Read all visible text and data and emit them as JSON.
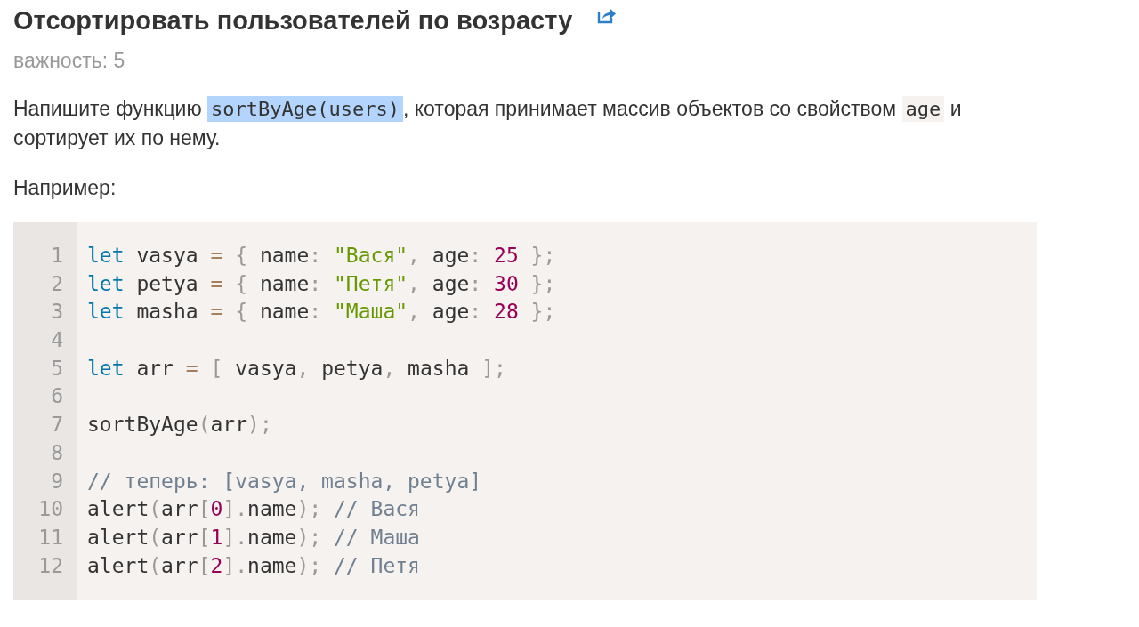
{
  "task": {
    "title": "Отсортировать пользователей по возрасту",
    "importance": "важность: 5"
  },
  "description": [
    {
      "kind": "text",
      "text": "Напишите функцию "
    },
    {
      "kind": "code",
      "text": "sortByAge(users)",
      "highlighted": true
    },
    {
      "kind": "text",
      "text": ", которая принимает массив объектов со свойством "
    },
    {
      "kind": "code",
      "text": "age",
      "highlighted": false
    },
    {
      "kind": "text",
      "text": " и сортирует их по нему."
    }
  ],
  "example_label": "Например:",
  "code": {
    "lines": [
      {
        "number": "1",
        "tokens": [
          {
            "kind": "keyword",
            "text": "let"
          },
          {
            "kind": "plain",
            "text": " vasya "
          },
          {
            "kind": "operator",
            "text": "="
          },
          {
            "kind": "punct",
            "text": " {"
          },
          {
            "kind": "plain",
            "text": " name"
          },
          {
            "kind": "punct",
            "text": ":"
          },
          {
            "kind": "string",
            "text": " \"Вася\""
          },
          {
            "kind": "punct",
            "text": ","
          },
          {
            "kind": "plain",
            "text": " age"
          },
          {
            "kind": "punct",
            "text": ":"
          },
          {
            "kind": "number",
            "text": " 25"
          },
          {
            "kind": "punct",
            "text": " };"
          }
        ]
      },
      {
        "number": "2",
        "tokens": [
          {
            "kind": "keyword",
            "text": "let"
          },
          {
            "kind": "plain",
            "text": " petya "
          },
          {
            "kind": "operator",
            "text": "="
          },
          {
            "kind": "punct",
            "text": " {"
          },
          {
            "kind": "plain",
            "text": " name"
          },
          {
            "kind": "punct",
            "text": ":"
          },
          {
            "kind": "string",
            "text": " \"Петя\""
          },
          {
            "kind": "punct",
            "text": ","
          },
          {
            "kind": "plain",
            "text": " age"
          },
          {
            "kind": "punct",
            "text": ":"
          },
          {
            "kind": "number",
            "text": " 30"
          },
          {
            "kind": "punct",
            "text": " };"
          }
        ]
      },
      {
        "number": "3",
        "tokens": [
          {
            "kind": "keyword",
            "text": "let"
          },
          {
            "kind": "plain",
            "text": " masha "
          },
          {
            "kind": "operator",
            "text": "="
          },
          {
            "kind": "punct",
            "text": " {"
          },
          {
            "kind": "plain",
            "text": " name"
          },
          {
            "kind": "punct",
            "text": ":"
          },
          {
            "kind": "string",
            "text": " \"Маша\""
          },
          {
            "kind": "punct",
            "text": ","
          },
          {
            "kind": "plain",
            "text": " age"
          },
          {
            "kind": "punct",
            "text": ":"
          },
          {
            "kind": "number",
            "text": " 28"
          },
          {
            "kind": "punct",
            "text": " };"
          }
        ]
      },
      {
        "number": "4"
      },
      {
        "number": "5",
        "tokens": [
          {
            "kind": "keyword",
            "text": "let"
          },
          {
            "kind": "plain",
            "text": " arr "
          },
          {
            "kind": "operator",
            "text": "="
          },
          {
            "kind": "punct",
            "text": " ["
          },
          {
            "kind": "plain",
            "text": " vasya"
          },
          {
            "kind": "punct",
            "text": ","
          },
          {
            "kind": "plain",
            "text": " petya"
          },
          {
            "kind": "punct",
            "text": ","
          },
          {
            "kind": "plain",
            "text": " masha "
          },
          {
            "kind": "punct",
            "text": "];"
          }
        ]
      },
      {
        "number": "6"
      },
      {
        "number": "7",
        "tokens": [
          {
            "kind": "plain",
            "text": "sortByAge"
          },
          {
            "kind": "punct",
            "text": "("
          },
          {
            "kind": "plain",
            "text": "arr"
          },
          {
            "kind": "punct",
            "text": ");"
          }
        ]
      },
      {
        "number": "8"
      },
      {
        "number": "9",
        "tokens": [
          {
            "kind": "comment",
            "text": "// теперь: [vasya, masha, petya]"
          }
        ]
      },
      {
        "number": "10",
        "tokens": [
          {
            "kind": "plain",
            "text": "alert"
          },
          {
            "kind": "punct",
            "text": "("
          },
          {
            "kind": "plain",
            "text": "arr"
          },
          {
            "kind": "punct",
            "text": "["
          },
          {
            "kind": "number",
            "text": "0"
          },
          {
            "kind": "punct",
            "text": "]."
          },
          {
            "kind": "plain",
            "text": "name"
          },
          {
            "kind": "punct",
            "text": ");"
          },
          {
            "kind": "comment",
            "text": " // Вася"
          }
        ]
      },
      {
        "number": "11",
        "tokens": [
          {
            "kind": "plain",
            "text": "alert"
          },
          {
            "kind": "punct",
            "text": "("
          },
          {
            "kind": "plain",
            "text": "arr"
          },
          {
            "kind": "punct",
            "text": "["
          },
          {
            "kind": "number",
            "text": "1"
          },
          {
            "kind": "punct",
            "text": "]."
          },
          {
            "kind": "plain",
            "text": "name"
          },
          {
            "kind": "punct",
            "text": ");"
          },
          {
            "kind": "comment",
            "text": " // Маша"
          }
        ]
      },
      {
        "number": "12",
        "tokens": [
          {
            "kind": "plain",
            "text": "alert"
          },
          {
            "kind": "punct",
            "text": "("
          },
          {
            "kind": "plain",
            "text": "arr"
          },
          {
            "kind": "punct",
            "text": "["
          },
          {
            "kind": "number",
            "text": "2"
          },
          {
            "kind": "punct",
            "text": "]."
          },
          {
            "kind": "plain",
            "text": "name"
          },
          {
            "kind": "punct",
            "text": ");"
          },
          {
            "kind": "comment",
            "text": " // Петя"
          }
        ]
      }
    ]
  }
}
